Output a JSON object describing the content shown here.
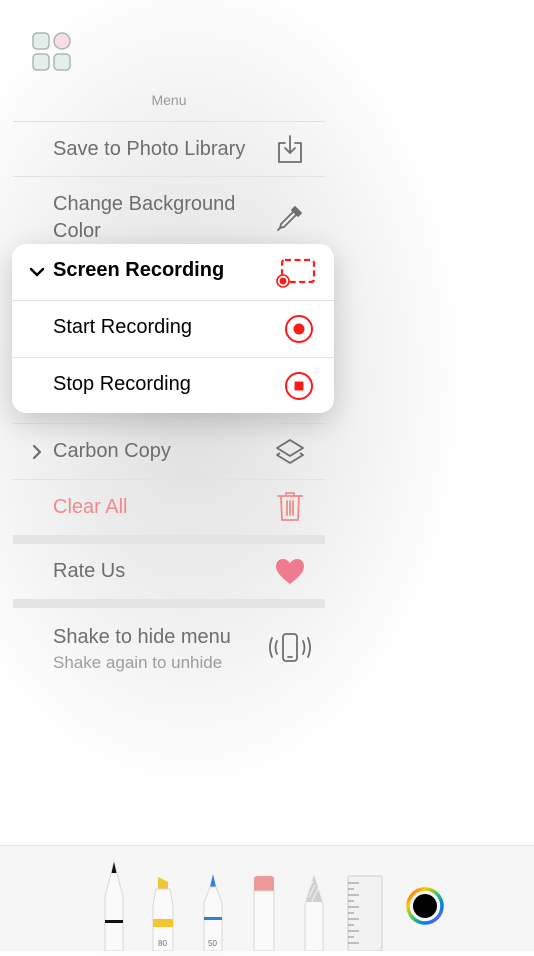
{
  "menu": {
    "title": "Menu",
    "save_label": "Save to Photo Library",
    "bg_label": "Change Background Color",
    "carbon_label": "Carbon Copy",
    "clear_label": "Clear All",
    "rate_label": "Rate Us",
    "shake_label": "Shake to hide menu",
    "shake_sub": "Shake again to unhide"
  },
  "recording": {
    "header": "Screen Recording",
    "start": "Start Recording",
    "stop": "Stop Recording"
  },
  "toolbar": {
    "marker_size": "80",
    "pen_size": "50"
  },
  "colors": {
    "accent_red": "#ff1a1a",
    "destructive": "#f08a8a",
    "heart": "#f07a90",
    "highlighter": "#f5c431",
    "pen_blue": "#2f7fe0",
    "eraser": "#ee9a9a"
  },
  "icons": {
    "apps": "apps-grid-icon",
    "save": "download-tray-icon",
    "bg": "eyedropper-icon",
    "recording": "screen-recording-icon",
    "start": "record-icon",
    "stop": "stop-icon",
    "carbon": "layers-icon",
    "clear": "trash-icon",
    "rate": "heart-icon",
    "shake": "phone-vibrate-icon",
    "color": "color-wheel-icon"
  }
}
